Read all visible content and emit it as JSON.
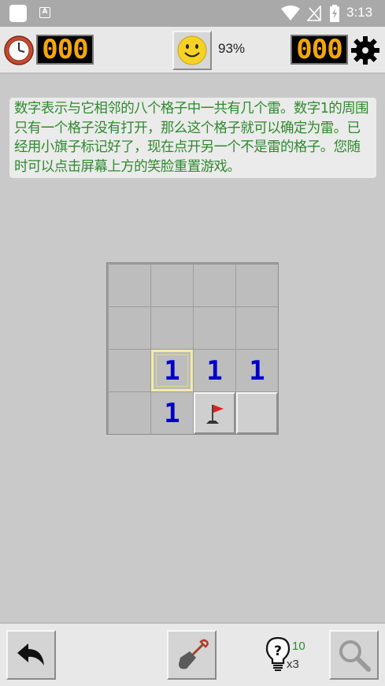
{
  "status_bar": {
    "time": "3:13",
    "icons": [
      "app-square-icon",
      "font-a-icon",
      "wifi-icon",
      "no-signal-icon",
      "battery-charging-icon"
    ]
  },
  "top_bar": {
    "timer": "000",
    "mines_remaining": "000",
    "win_percent": "93%",
    "icons": [
      "clock-icon",
      "smiley-face-icon",
      "gear-icon"
    ]
  },
  "hint_text": "数字表示与它相邻的八个格子中一共有几个雷。数字1的周围只有一个格子没有打开，那么这个格子就可以确定为雷。已经用小旗子标记好了，现在点开另一个不是雷的格子。您随时可以点击屏幕上方的笑脸重置游戏。",
  "board": {
    "rows": 4,
    "cols": 4,
    "cells": [
      [
        "",
        "",
        "",
        ""
      ],
      [
        "",
        "",
        "",
        ""
      ],
      [
        "",
        "1",
        "1",
        "1"
      ],
      [
        "",
        "1",
        "flag",
        "closed"
      ]
    ],
    "selected_cell": [
      2,
      1
    ],
    "number_color": "#0000cc"
  },
  "bottom_bar": {
    "hints_available": "10",
    "hint_multiplier": "x3",
    "icons": [
      "undo-arrow-icon",
      "shovel-icon",
      "lightbulb-icon",
      "magnifier-icon"
    ]
  }
}
